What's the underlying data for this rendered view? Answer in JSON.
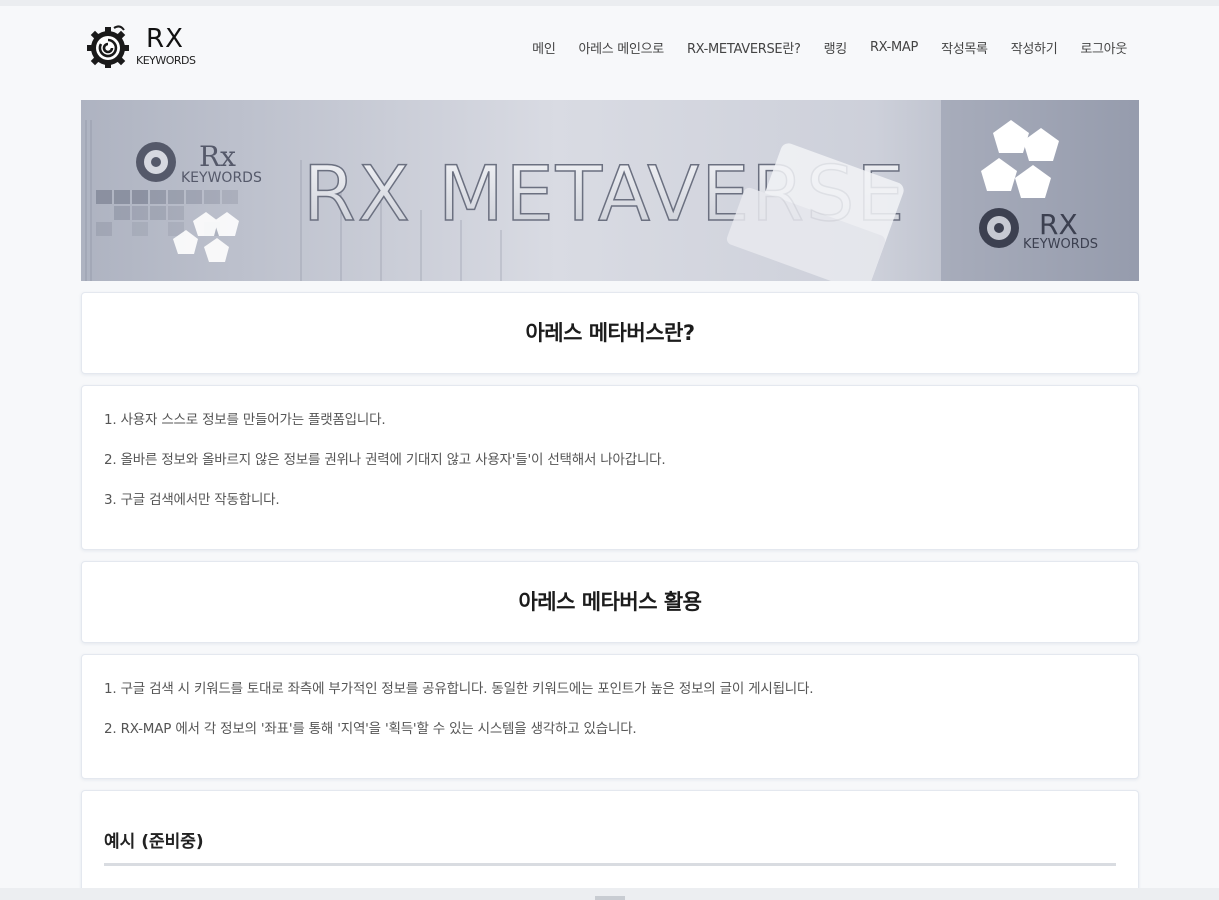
{
  "brand": {
    "logo_main": "RX",
    "logo_sub": "KEYWORDS"
  },
  "nav": {
    "items": [
      {
        "label": "메인"
      },
      {
        "label": "아레스 메인으로"
      },
      {
        "label": "RX-METAVERSE란?"
      },
      {
        "label": "랭킹"
      },
      {
        "label": "RX-MAP"
      },
      {
        "label": "작성목록"
      },
      {
        "label": "작성하기"
      },
      {
        "label": "로그아웃"
      }
    ]
  },
  "banner": {
    "title": "RX METAVERSE",
    "logo_left_main": "Rx",
    "logo_left_sub": "KEYWORDS",
    "logo_right_main": "RX",
    "logo_right_sub": "KEYWORDS"
  },
  "section1": {
    "title": "아레스 메타버스란?",
    "items": [
      "1. 사용자 스스로 정보를 만들어가는 플랫폼입니다.",
      "2. 올바른 정보와 올바르지 않은 정보를 권위나 권력에 기대지 않고 사용자'들'이 선택해서 나아갑니다.",
      "3. 구글 검색에서만 작동합니다."
    ]
  },
  "section2": {
    "title": "아레스 메타버스 활용",
    "items": [
      "1. 구글 검색 시 키워드를 토대로 좌측에 부가적인 정보를 공유합니다. 동일한 키워드에는 포인트가 높은 정보의 글이 게시됩니다.",
      "2. RX-MAP 에서 각 정보의 '좌표'를 통해 '지역'을 '획득'할 수 있는 시스템을 생각하고 있습니다."
    ]
  },
  "section3": {
    "title": "예시 (준비중)"
  },
  "colors": {
    "page_bg": "#f7f8fa",
    "card_bg": "#ffffff",
    "card_border": "#e4e8ef",
    "text": "#333333"
  }
}
